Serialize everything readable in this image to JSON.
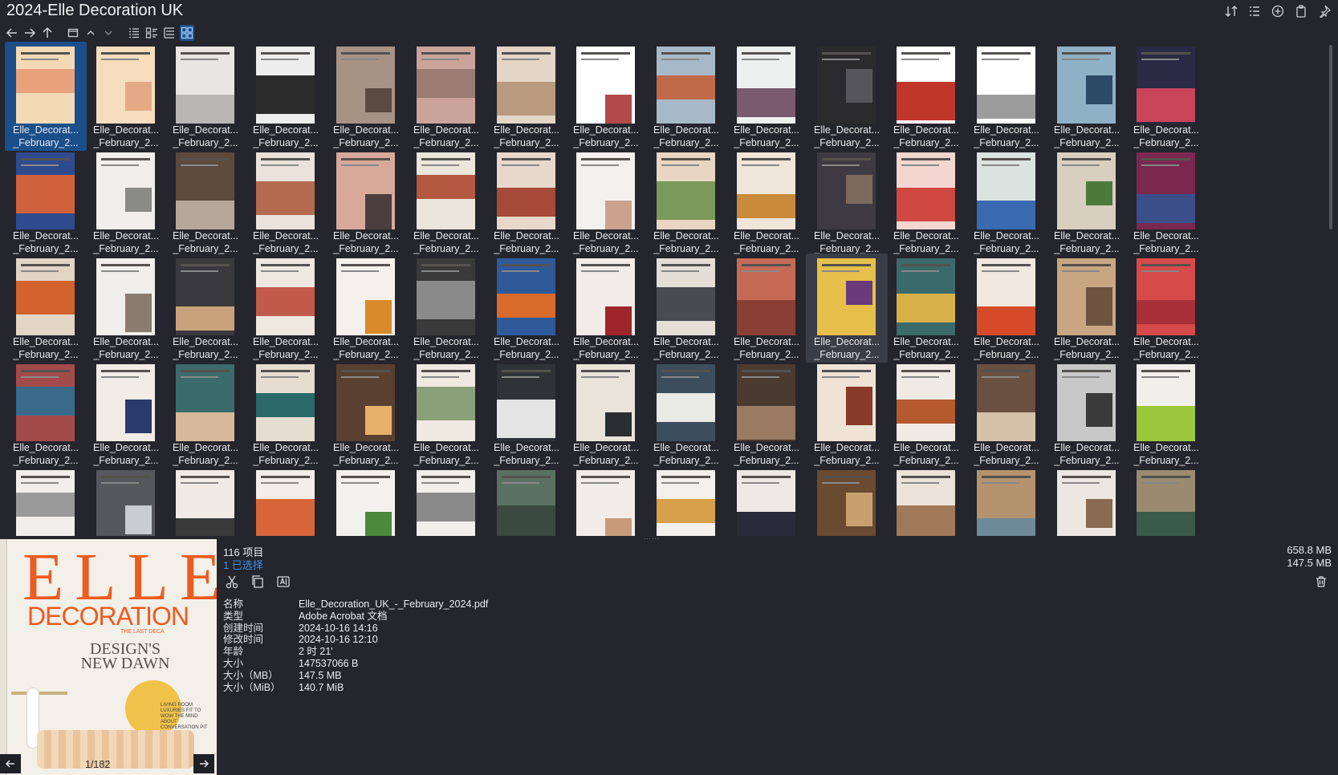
{
  "window": {
    "title": "2024-Elle Decoration UK"
  },
  "tile_name": {
    "line1": "Elle_Decorat...",
    "line2": "_February_2..."
  },
  "tiles": [
    {
      "c": [
        "#f3d9b6",
        "#e9a27c"
      ]
    },
    {
      "c": [
        "#f5ddbd",
        "#e6a986"
      ]
    },
    {
      "c": [
        "#e8e6e3",
        "#b9b7b3"
      ]
    },
    {
      "c": [
        "#ededed",
        "#2b2b2b"
      ]
    },
    {
      "c": [
        "#a79385",
        "#5a4a42"
      ]
    },
    {
      "c": [
        "#caa49a",
        "#9b7b72"
      ]
    },
    {
      "c": [
        "#e3d6c6",
        "#b99a7e"
      ]
    },
    {
      "c": [
        "#ffffff",
        "#b24a4a"
      ]
    },
    {
      "c": [
        "#a7b9c8",
        "#c06a4a"
      ]
    },
    {
      "c": [
        "#eef0f0",
        "#7a5a6e"
      ]
    },
    {
      "c": [
        "#2b2b2e",
        "#56565a"
      ]
    },
    {
      "c": [
        "#ffffff",
        "#c0362b"
      ]
    },
    {
      "c": [
        "#ffffff",
        "#9c9c9c"
      ]
    },
    {
      "c": [
        "#8fb1c6",
        "#2c4a66"
      ]
    },
    {
      "c": [
        "#2a2a44",
        "#c8455a"
      ]
    },
    {
      "c": [
        "#2f4b8f",
        "#d0623b"
      ]
    },
    {
      "c": [
        "#f0efeb",
        "#8a8a86"
      ]
    },
    {
      "c": [
        "#5d4a3c",
        "#b6a79a"
      ]
    },
    {
      "c": [
        "#ebe3db",
        "#b46a4e"
      ]
    },
    {
      "c": [
        "#d8a99a",
        "#4a3e3e"
      ]
    },
    {
      "c": [
        "#ebe5dc",
        "#b2593f"
      ]
    },
    {
      "c": [
        "#e7d8cb",
        "#a74a38"
      ]
    },
    {
      "c": [
        "#f3f1ee",
        "#caa28e"
      ]
    },
    {
      "c": [
        "#e9d6c2",
        "#7a9a5a"
      ]
    },
    {
      "c": [
        "#efe5d8",
        "#c98a3a"
      ]
    },
    {
      "c": [
        "#3d3a44",
        "#7c6a5a"
      ]
    },
    {
      "c": [
        "#f3d6d0",
        "#d0473f"
      ]
    },
    {
      "c": [
        "#dbe3e0",
        "#3a6ab0"
      ]
    },
    {
      "c": [
        "#d8cfbf",
        "#4c7a3a"
      ]
    },
    {
      "c": [
        "#7a2850",
        "#3b4e8a"
      ]
    },
    {
      "c": [
        "#e2d5c6",
        "#d4622e"
      ]
    },
    {
      "c": [
        "#f1efec",
        "#8a7d70"
      ]
    },
    {
      "c": [
        "#3a3a3e",
        "#c8a27a"
      ]
    },
    {
      "c": [
        "#efe8e0",
        "#c25a4a"
      ]
    },
    {
      "c": [
        "#f4f1ec",
        "#d98a2a"
      ]
    },
    {
      "c": [
        "#3a3a3a",
        "#8a8a8a"
      ]
    },
    {
      "c": [
        "#2e5a9a",
        "#d86a2a"
      ]
    },
    {
      "c": [
        "#f1ece7",
        "#a0252a"
      ]
    },
    {
      "c": [
        "#e5ded6",
        "#4a4a52"
      ]
    },
    {
      "c": [
        "#c66a55",
        "#8a3f34"
      ]
    },
    {
      "c": [
        "#e6c04a",
        "#6a3a7a"
      ]
    },
    {
      "c": [
        "#3a6a6a",
        "#d8b04a"
      ]
    },
    {
      "c": [
        "#f1e8df",
        "#d64a2a"
      ]
    },
    {
      "c": [
        "#c8a682",
        "#6e5440"
      ]
    },
    {
      "c": [
        "#d64a4a",
        "#a82e38"
      ]
    },
    {
      "c": [
        "#a34a4a",
        "#3a6a8a"
      ]
    },
    {
      "c": [
        "#f1ece6",
        "#2a3a6a"
      ]
    },
    {
      "c": [
        "#3b6b6a",
        "#d8b89a"
      ]
    },
    {
      "c": [
        "#e6ddd1",
        "#2a6a6a"
      ]
    },
    {
      "c": [
        "#5a4030",
        "#e8b06a"
      ]
    },
    {
      "c": [
        "#efe9e2",
        "#8aa07a"
      ]
    },
    {
      "c": [
        "#2f3338",
        "#e4e4e4"
      ]
    },
    {
      "c": [
        "#e9e3da",
        "#2a2e30"
      ]
    },
    {
      "c": [
        "#3c4e5e",
        "#e9e9e6"
      ]
    },
    {
      "c": [
        "#4a3a30",
        "#9a7a60"
      ]
    },
    {
      "c": [
        "#efe3d6",
        "#8a3a2a"
      ]
    },
    {
      "c": [
        "#f0ebe4",
        "#b45a2e"
      ]
    },
    {
      "c": [
        "#6a5040",
        "#d6c2aa"
      ]
    },
    {
      "c": [
        "#c8c8c8",
        "#3a3a3a"
      ]
    },
    {
      "c": [
        "#f1efe9",
        "#9ac83a"
      ]
    },
    {
      "c": [
        "#f1efec",
        "#9a9a9a"
      ]
    },
    {
      "c": [
        "#55565e",
        "#c9ccd2"
      ]
    },
    {
      "c": [
        "#f0ebe5",
        "#3a3a3a"
      ]
    },
    {
      "c": [
        "#f2eeea",
        "#d8643a"
      ]
    },
    {
      "c": [
        "#f3f1ee",
        "#4a8a3a"
      ]
    },
    {
      "c": [
        "#f1efec",
        "#8a8a8a"
      ]
    },
    {
      "c": [
        "#5a7060",
        "#3a4a40"
      ]
    },
    {
      "c": [
        "#f1ece7",
        "#c89a7a"
      ]
    },
    {
      "c": [
        "#f2f0ed",
        "#d8a04a"
      ]
    },
    {
      "c": [
        "#ece9e4",
        "#2a2a3a"
      ]
    },
    {
      "c": [
        "#6a4a30",
        "#c8a070"
      ]
    },
    {
      "c": [
        "#ebe3d9",
        "#a0785a"
      ]
    },
    {
      "c": [
        "#b4936e",
        "#6e8a9a"
      ]
    },
    {
      "c": [
        "#ece7e1",
        "#8a6a50"
      ]
    },
    {
      "c": [
        "#9a8a70",
        "#3a5a4a"
      ]
    }
  ],
  "preview": {
    "cover_title": "ELLE",
    "cover_subtitle": "DECORATION",
    "cover_label": "THE LAST DECA",
    "headline": "DESIGN'S NEW DAWN",
    "cover_tag": "LIVING ROOM LUXURIES FIT TO WOW THE MIND ABOUT CONVERSATION PIT",
    "page_indicator": "1/182"
  },
  "info": {
    "item_count": "116 项目",
    "selected_count": "1 已选择",
    "total_size": "658.8 MB",
    "selected_size": "147.5 MB",
    "properties": [
      {
        "key": "名称",
        "value": "Elle_Decoration_UK_-_February_2024.pdf"
      },
      {
        "key": "类型",
        "value": "Adobe Acrobat 文档"
      },
      {
        "key": "创建时间",
        "value": "2024-10-16  14:16"
      },
      {
        "key": "修改时间",
        "value": "2024-10-16  12:10"
      },
      {
        "key": "年龄",
        "value": "2 时 21'"
      },
      {
        "key": "大小",
        "value": "147537066 B"
      },
      {
        "key": "大小（MB）",
        "value": "147.5 MB"
      },
      {
        "key": "大小（MiB）",
        "value": "140.7 MiB"
      }
    ]
  },
  "icons": {
    "top": [
      "sort-icon",
      "details-icon",
      "add-icon",
      "clipboard-icon",
      "pin-icon"
    ],
    "toolbar": [
      "back-arrow-icon",
      "forward-arrow-icon",
      "up-arrow-icon",
      "window-icon",
      "chevron-up-icon",
      "chevron-down-icon",
      "list-view-icon",
      "details-view-icon",
      "tree-view-icon",
      "grid-view-icon"
    ],
    "actions": [
      "scissors-icon",
      "copy-icon",
      "rename-icon"
    ]
  },
  "colors": {
    "accent": "#1a4f8a",
    "link": "#3d8fe6",
    "background": "#25252d"
  }
}
